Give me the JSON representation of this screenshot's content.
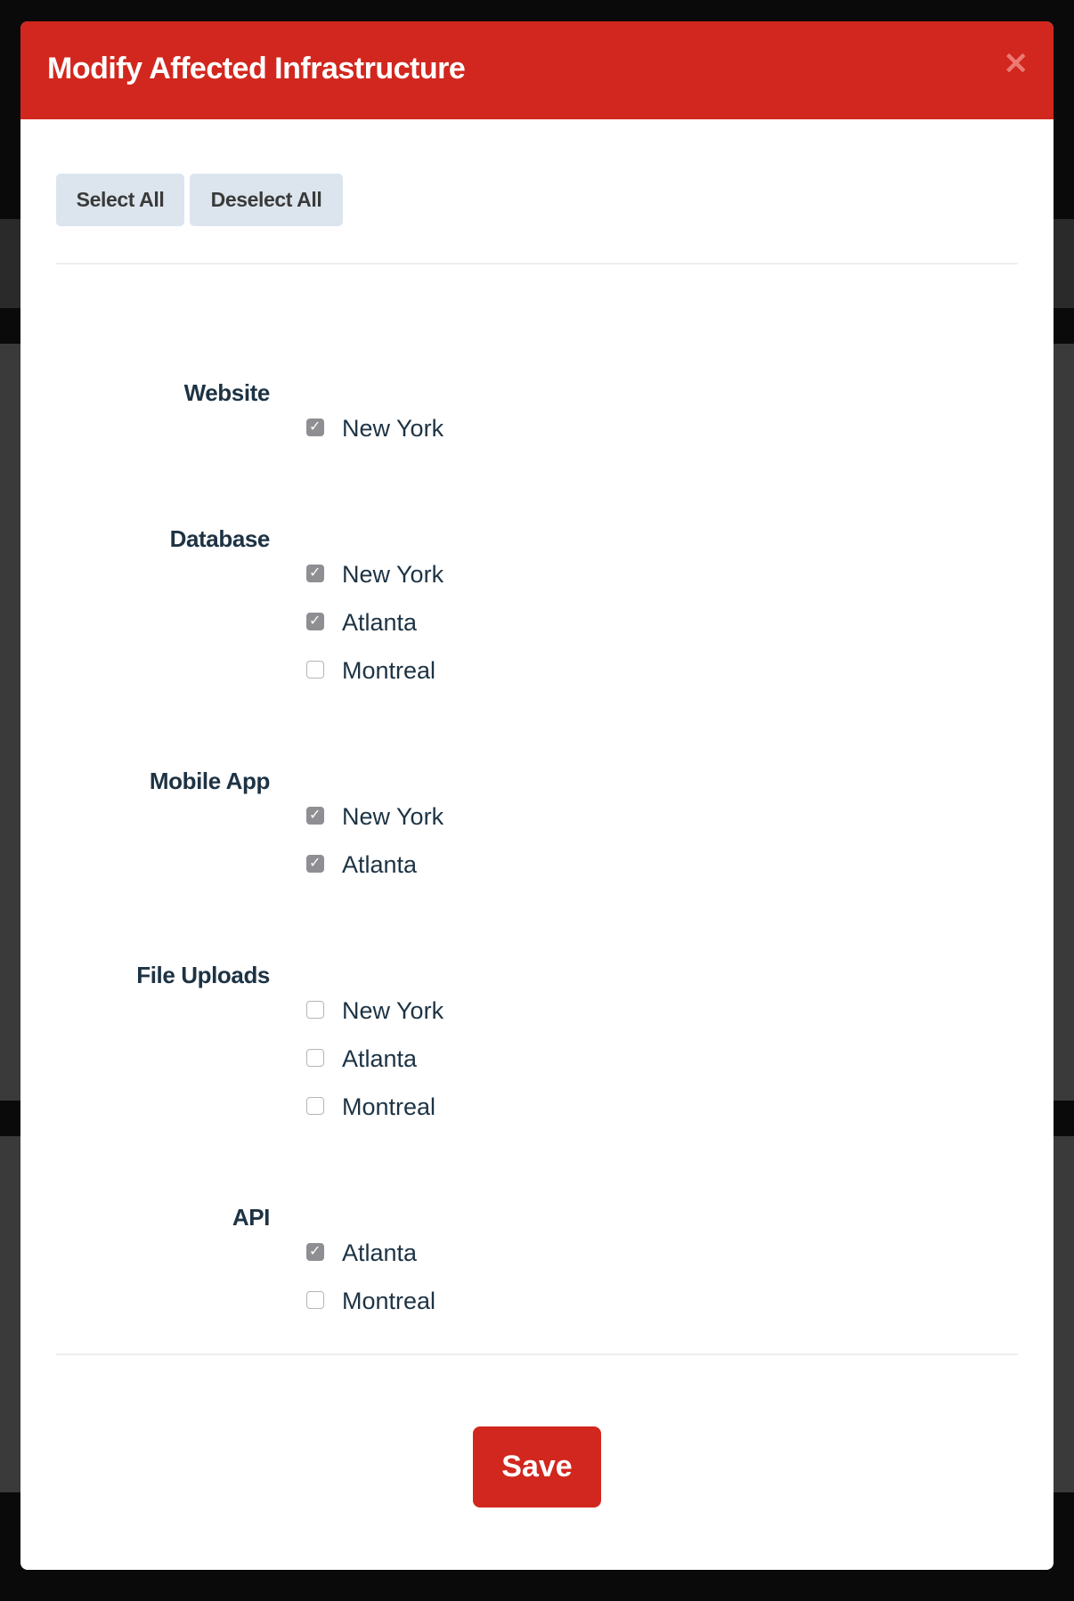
{
  "modal": {
    "title": "Modify Affected Infrastructure",
    "close_icon": "close-icon",
    "select_all_label": "Select All",
    "deselect_all_label": "Deselect All",
    "save_label": "Save",
    "colors": {
      "header": "#d2271e",
      "save": "#d2271e",
      "checked": "#8e8e93"
    }
  },
  "groups": [
    {
      "label": "Website",
      "items": [
        {
          "label": "New York",
          "checked": true
        }
      ]
    },
    {
      "label": "Database",
      "items": [
        {
          "label": "New York",
          "checked": true
        },
        {
          "label": "Atlanta",
          "checked": true
        },
        {
          "label": "Montreal",
          "checked": false
        }
      ]
    },
    {
      "label": "Mobile App",
      "items": [
        {
          "label": "New York",
          "checked": true
        },
        {
          "label": "Atlanta",
          "checked": true
        }
      ]
    },
    {
      "label": "File Uploads",
      "items": [
        {
          "label": "New York",
          "checked": false
        },
        {
          "label": "Atlanta",
          "checked": false
        },
        {
          "label": "Montreal",
          "checked": false
        }
      ]
    },
    {
      "label": "API",
      "items": [
        {
          "label": "Atlanta",
          "checked": true
        },
        {
          "label": "Montreal",
          "checked": false
        }
      ]
    }
  ]
}
